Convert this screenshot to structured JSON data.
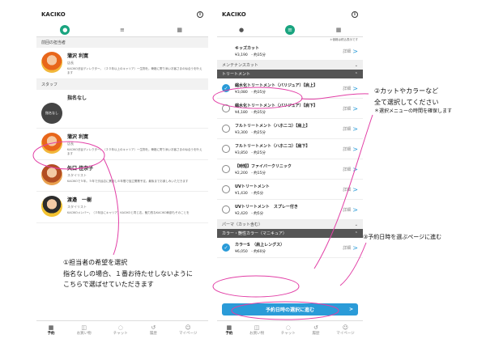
{
  "left": {
    "app_title": "KACIKO",
    "section_last": "前回の担当者",
    "section_staff": "スタッフ",
    "last_staff": {
      "name": "蒲沢 利寛",
      "role": "店長",
      "desc": "KACIKO渋谷ディレクター。（２０年以上のキャリア）一生物を。骨格に寄り添いお客さまの似合うを叶えます"
    },
    "staff": [
      {
        "name": "指名なし",
        "role": "",
        "desc": "",
        "avatar_text": "指名なし"
      },
      {
        "name": "蒲沢 利寛",
        "role": "店長",
        "desc": "KACIKO渋谷ディレクター。（２０年以上のキャリア）一生物を。骨格に寄り添いお客さまの似合うを叶えます"
      },
      {
        "name": "矢口 佳奈子",
        "role": "スタイリスト",
        "desc": "KACIKOで５年。５年で渋谷店に異動し６年間で独立開業予定。最後までお楽しみいただきます"
      },
      {
        "name": "渡邉　一樹",
        "role": "スタイリスト",
        "desc": "KACIKOメンバー。（３年目にキャリア）KACIKOと同じ志。魅力的なKACIKO幹部もそのことを"
      }
    ],
    "nav": [
      "予約",
      "お買い物",
      "チャット",
      "履歴",
      "マイページ"
    ]
  },
  "right": {
    "app_title": "KACIKO",
    "notice": "＊価格は税込表示です",
    "detail_label": "詳細",
    "cat_maintenance": "メンテナンスカット",
    "cat_treatment": "トリートメント",
    "cat_perm": "パーマ（カット含む）",
    "cat_color": "カラー・艶性カラー（マニキュア）",
    "kids": {
      "name": "キッズカット",
      "price": "¥3,190　- 約35分"
    },
    "treatments": [
      {
        "name": "縮水化トリートメント（バリジュア）【肩上】",
        "price": "¥3,080　- 約35分",
        "checked": true
      },
      {
        "name": "縮水化トリートメント（バリジュア）【肩下】",
        "price": "¥4,180　- 約35分",
        "checked": false
      },
      {
        "name": "フルトリートメント（ハホニコ）【肩上】",
        "price": "¥3,300　- 約25分",
        "checked": false
      },
      {
        "name": "フルトリートメント（ハホニコ）【肩下】",
        "price": "¥3,850　- 約25分",
        "checked": false
      },
      {
        "name": "【時短】ファイバークリニック",
        "price": "¥2,200　- 約15分",
        "checked": false
      },
      {
        "name": "UVトリートメント",
        "price": "¥1,430　- 約5分",
        "checked": false
      },
      {
        "name": "UVトリートメント　スプレー付き",
        "price": "¥2,420　- 約5分",
        "checked": false
      }
    ],
    "color_item": {
      "name": "カラーS　（肩上レングス）",
      "price": "¥6,050　- 約60分",
      "checked": true
    },
    "cta_label": "予約日時の選択に進む",
    "nav": [
      "予約",
      "お買い物",
      "チャット",
      "履歴",
      "マイページ"
    ]
  },
  "annotations": {
    "a1_line1": "①担当者の希望を選択",
    "a1_line2": "指名なしの場合、１番お待たせしないように",
    "a1_line3": "こちらで選ばせていただきます",
    "a2_line1": "②カットやカラーなど",
    "a2_line2": "全て選択してください",
    "a2_note": "＊選択メニューの時間を確保します",
    "a3": "③予約日時を選ぶページに進む"
  },
  "colors": {
    "accent_green": "#19a47f",
    "accent_blue": "#2a9bd8",
    "annotation_pink": "#e23fa6"
  }
}
